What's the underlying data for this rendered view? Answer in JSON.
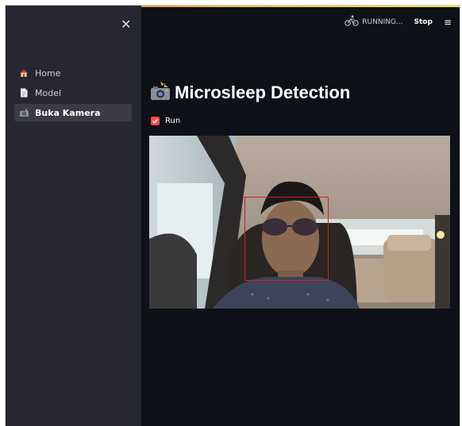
{
  "sidebar": {
    "close_symbol": "✕",
    "items": [
      {
        "label": "Home",
        "icon": "house-icon",
        "active": false
      },
      {
        "label": "Model",
        "icon": "document-icon",
        "active": false
      },
      {
        "label": "Buka Kamera",
        "icon": "camera-flash-icon",
        "active": true
      }
    ]
  },
  "header": {
    "status": "RUNNING...",
    "status_icon": "cyclist-icon",
    "stop_label": "Stop",
    "menu_symbol": "≡"
  },
  "main": {
    "title": "Microsleep Detection",
    "title_icon": "camera-flash-icon",
    "checkbox": {
      "label": "Run",
      "checked": true
    },
    "video": {
      "detection": "face-bounding-box"
    }
  },
  "colors": {
    "accent": "#ff4b4b",
    "sidebar_bg": "#262730",
    "main_bg": "#0e1117",
    "detection_box": "#d61c1c"
  }
}
